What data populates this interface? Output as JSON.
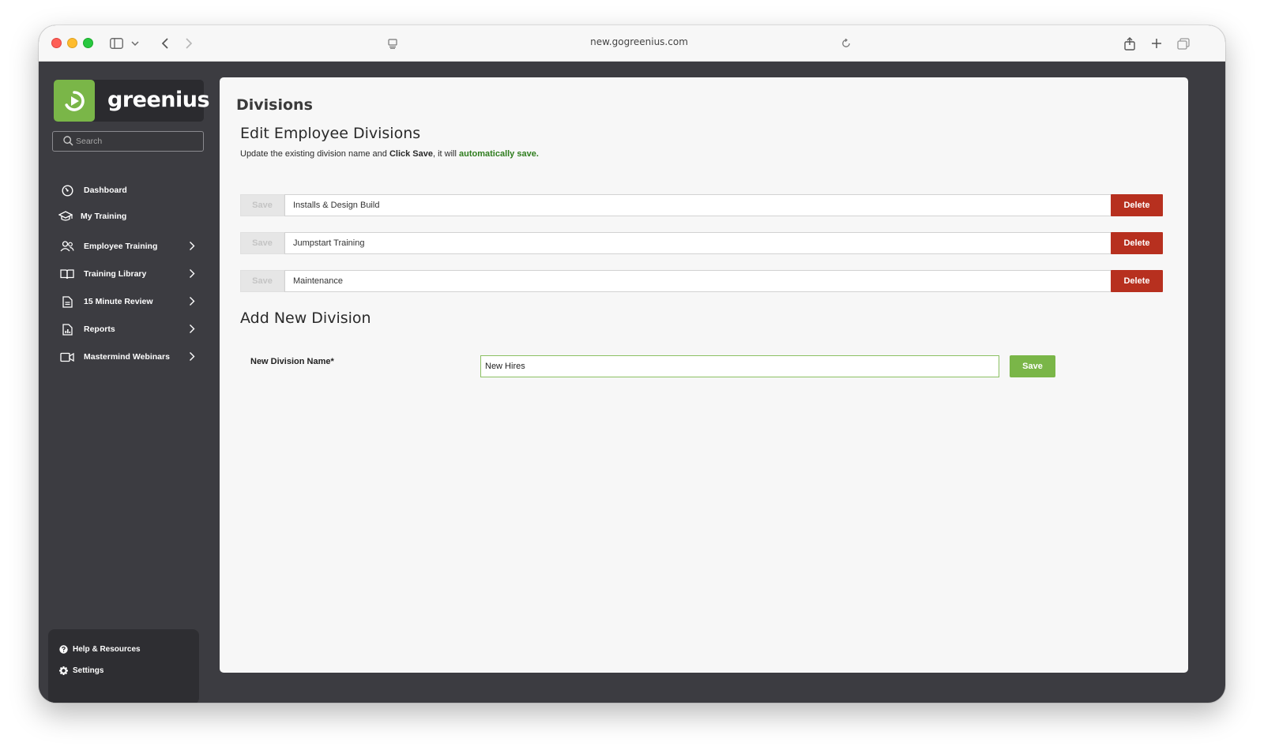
{
  "browser": {
    "url": "new.gogreenius.com"
  },
  "sidebar": {
    "logo_text": "greenius",
    "search_placeholder": "Search",
    "items": [
      {
        "label": "Dashboard",
        "icon": "dashboard-gauge-icon",
        "has_submenu": false
      },
      {
        "label": "My Training",
        "icon": "graduation-cap-icon",
        "has_submenu": false
      },
      {
        "label": "Employee Training",
        "icon": "users-icon",
        "has_submenu": true
      },
      {
        "label": "Training Library",
        "icon": "open-book-icon",
        "has_submenu": true
      },
      {
        "label": "15 Minute Review",
        "icon": "document-icon",
        "has_submenu": true
      },
      {
        "label": "Reports",
        "icon": "report-chart-icon",
        "has_submenu": true
      },
      {
        "label": "Mastermind Webinars",
        "icon": "video-camera-icon",
        "has_submenu": true
      }
    ],
    "footer": [
      {
        "label": "Help & Resources",
        "icon": "question-circle-icon"
      },
      {
        "label": "Settings",
        "icon": "gear-icon"
      }
    ]
  },
  "main": {
    "page_title": "Divisions",
    "edit_section_title": "Edit Employee Divisions",
    "description": {
      "part1": "Update the existing division name and ",
      "bold": "Click Save",
      "part2": ", it will ",
      "green": "automatically save."
    },
    "divisions": [
      {
        "name": "Installs & Design Build",
        "save_label": "Save",
        "delete_label": "Delete"
      },
      {
        "name": "Jumpstart Training",
        "save_label": "Save",
        "delete_label": "Delete"
      },
      {
        "name": "Maintenance",
        "save_label": "Save",
        "delete_label": "Delete"
      }
    ],
    "add_section_title": "Add New Division",
    "new_division": {
      "label": "New Division Name*",
      "value": "New Hires",
      "save_label": "Save"
    }
  },
  "colors": {
    "brand_green": "#7ab648",
    "delete_red": "#b7301f",
    "sidebar_bg": "#3c3c41"
  }
}
